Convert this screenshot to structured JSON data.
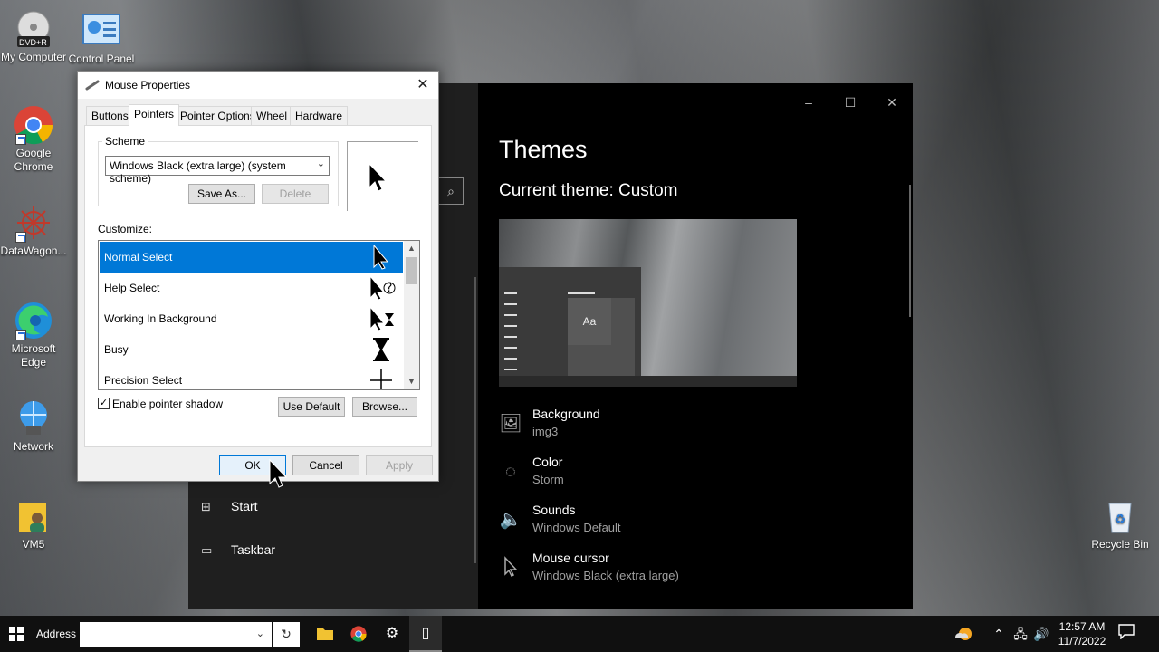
{
  "desktop": {
    "icons": [
      {
        "label": "My Computer",
        "sub": "DVD+R"
      },
      {
        "label": "Control Panel"
      },
      {
        "label": "Google Chrome"
      },
      {
        "label": "DataWagon..."
      },
      {
        "label": "Microsoft Edge"
      },
      {
        "label": "Network"
      },
      {
        "label": "VM5"
      },
      {
        "label": "Recycle Bin"
      }
    ]
  },
  "settings": {
    "title": "Themes",
    "current_theme": "Current theme: Custom",
    "preview_text": "Aa",
    "items": [
      {
        "label": "Background",
        "value": "img3",
        "icon": "picture-icon"
      },
      {
        "label": "Color",
        "value": "Storm",
        "icon": "palette-icon"
      },
      {
        "label": "Sounds",
        "value": "Windows Default",
        "icon": "speaker-icon"
      },
      {
        "label": "Mouse cursor",
        "value": "Windows Black (extra large)",
        "icon": "cursor-icon"
      }
    ],
    "nav": [
      {
        "label": "Start",
        "icon": "start-icon"
      },
      {
        "label": "Taskbar",
        "icon": "taskbar-icon"
      }
    ]
  },
  "dialog": {
    "title": "Mouse Properties",
    "tabs": [
      "Buttons",
      "Pointers",
      "Pointer Options",
      "Wheel",
      "Hardware"
    ],
    "active_tab": "Pointers",
    "scheme_label": "Scheme",
    "scheme_value": "Windows Black (extra large) (system scheme)",
    "save_as": "Save As...",
    "delete": "Delete",
    "customize_label": "Customize:",
    "list": [
      {
        "label": "Normal Select",
        "selected": true
      },
      {
        "label": "Help Select",
        "selected": false
      },
      {
        "label": "Working In Background",
        "selected": false
      },
      {
        "label": "Busy",
        "selected": false
      },
      {
        "label": "Precision Select",
        "selected": false
      }
    ],
    "enable_shadow": "Enable pointer shadow",
    "enable_shadow_checked": true,
    "use_default": "Use Default",
    "browse": "Browse...",
    "ok": "OK",
    "cancel": "Cancel",
    "apply": "Apply"
  },
  "taskbar": {
    "address_label": "Address",
    "address_value": "",
    "time": "12:57 AM",
    "date": "11/7/2022"
  }
}
